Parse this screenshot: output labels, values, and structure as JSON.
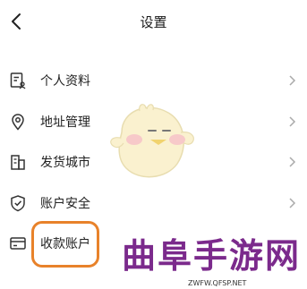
{
  "header": {
    "title": "设置"
  },
  "menu": {
    "items": [
      {
        "label": "个人资料",
        "icon": "profile-card-icon"
      },
      {
        "label": "地址管理",
        "icon": "location-pin-icon"
      },
      {
        "label": "发货城市",
        "icon": "city-building-icon"
      },
      {
        "label": "账户安全",
        "icon": "shield-check-icon"
      },
      {
        "label": "收款账户",
        "icon": "bank-card-icon"
      }
    ]
  },
  "highlight_color": "#e8822a",
  "watermark": {
    "text": "曲阜手游网",
    "url": "ZWFW.QFSP.NET",
    "color": "#7b2a8c"
  }
}
